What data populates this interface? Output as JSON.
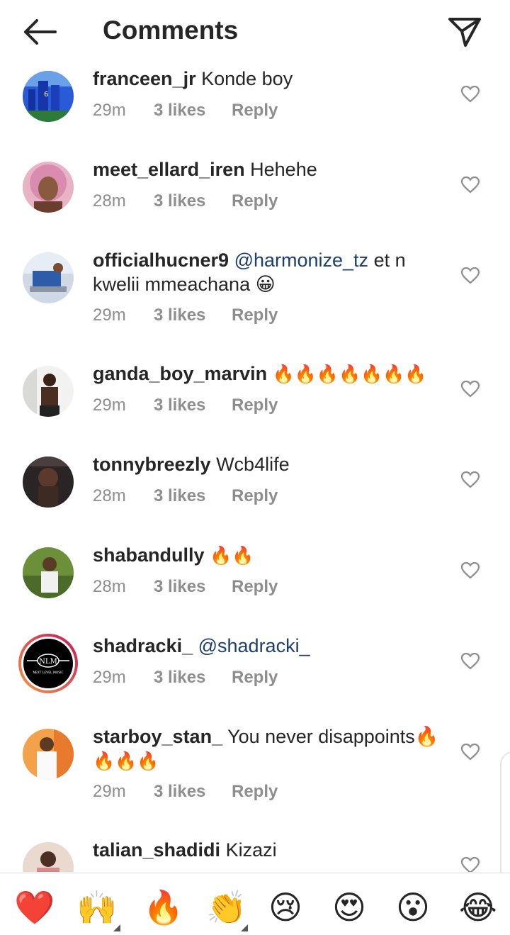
{
  "header": {
    "title": "Comments",
    "back_icon": "arrow-left-icon",
    "share_icon": "paper-plane-icon"
  },
  "comments": [
    {
      "user": "franceen_jr",
      "text": "Konde boy",
      "time": "29m",
      "likes": "3 likes",
      "reply": "Reply"
    },
    {
      "user": "meet_ellard_iren",
      "text": "Hehehe",
      "time": "28m",
      "likes": "3 likes",
      "reply": "Reply"
    },
    {
      "user": "officialhucner9",
      "mention": "@harmonize_tz",
      "text_after": "et n",
      "text_line2": "kwelii mmeachana 😀",
      "time": "29m",
      "likes": "3 likes",
      "reply": "Reply"
    },
    {
      "user": "ganda_boy_marvin",
      "text": "🔥🔥🔥🔥🔥🔥🔥",
      "time": "29m",
      "likes": "3 likes",
      "reply": "Reply"
    },
    {
      "user": "tonnybreezly",
      "text": "Wcb4life",
      "time": "28m",
      "likes": "3 likes",
      "reply": "Reply"
    },
    {
      "user": "shabandully",
      "text": "🔥🔥",
      "time": "28m",
      "likes": "3 likes",
      "reply": "Reply"
    },
    {
      "user": "shadracki_",
      "mention": "@shadracki_",
      "avatar_text": "NLM",
      "avatar_subtext": "NEXT LEVEL MUSIC",
      "time": "29m",
      "likes": "3 likes",
      "reply": "Reply"
    },
    {
      "user": "starboy_stan_",
      "text": "You never disappoints🔥",
      "text_line2": "🔥🔥🔥",
      "time": "29m",
      "likes": "3 likes",
      "reply": "Reply"
    },
    {
      "user": "talian_shadidi",
      "text": "Kizazi"
    }
  ],
  "reactions": [
    "❤️",
    "🙌",
    "🔥",
    "👏",
    "😢",
    "😍",
    "😮",
    "😂"
  ],
  "colors": {
    "mention": "#1d3f6e",
    "meta": "#8e8e8e",
    "ring_start": "#f2994a",
    "ring_end": "#c2185b"
  }
}
